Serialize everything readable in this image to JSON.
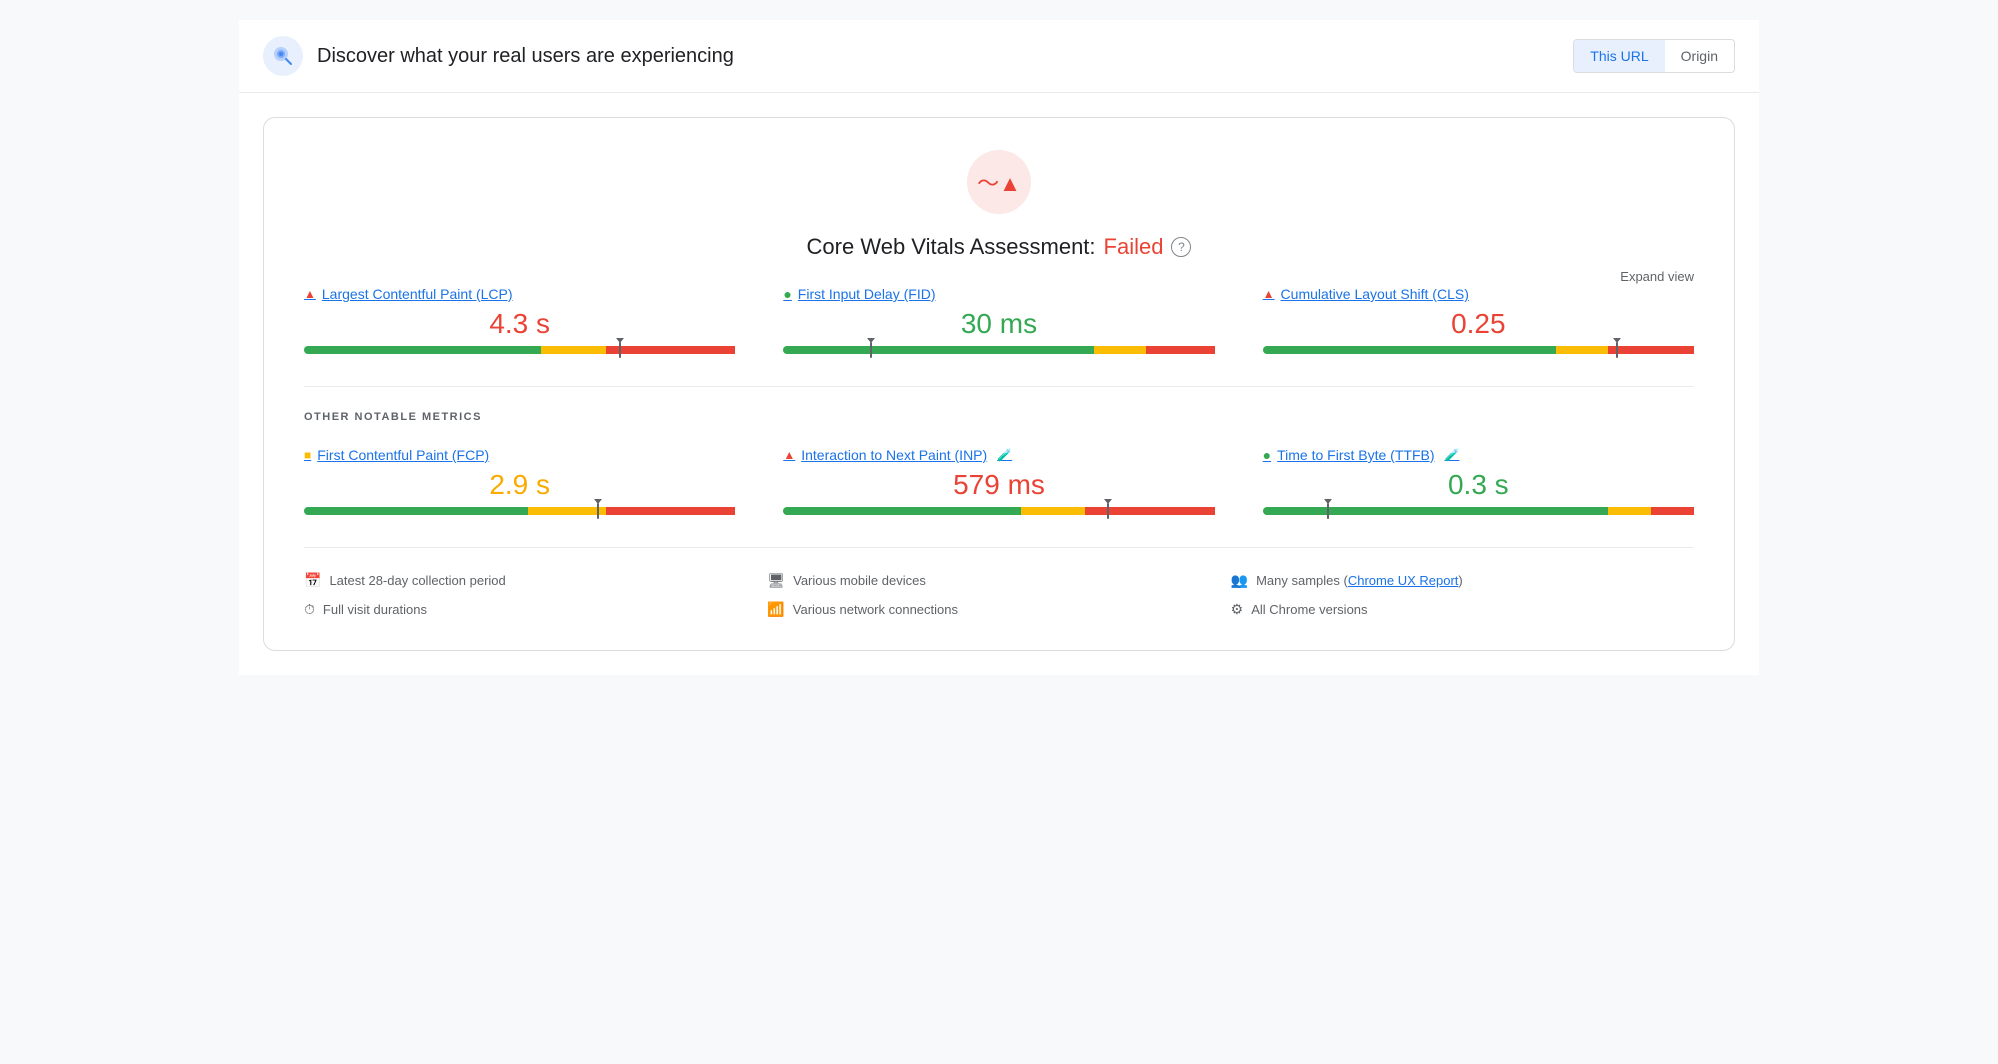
{
  "header": {
    "title": "Discover what your real users are experiencing",
    "toggle": {
      "this_url": "This URL",
      "origin": "Origin",
      "active": "this_url"
    },
    "logo_alt": "PageSpeed Insights logo"
  },
  "assessment": {
    "title_prefix": "Core Web Vitals Assessment: ",
    "status": "Failed",
    "help_label": "?",
    "expand_label": "Expand view"
  },
  "core_metrics": [
    {
      "id": "lcp",
      "icon_type": "triangle",
      "icon_color": "red",
      "title": "Largest Contentful Paint (LCP)",
      "value": "4.3 s",
      "value_color": "red",
      "bar": {
        "green": 55,
        "orange": 15,
        "red": 30,
        "marker_pct": 73
      }
    },
    {
      "id": "fid",
      "icon_type": "circle",
      "icon_color": "green",
      "title": "First Input Delay (FID)",
      "value": "30 ms",
      "value_color": "green",
      "bar": {
        "green": 72,
        "orange": 12,
        "red": 16,
        "marker_pct": 20
      }
    },
    {
      "id": "cls",
      "icon_type": "triangle",
      "icon_color": "red",
      "title": "Cumulative Layout Shift (CLS)",
      "value": "0.25",
      "value_color": "red",
      "bar": {
        "green": 68,
        "orange": 12,
        "red": 20,
        "marker_pct": 82
      }
    }
  ],
  "other_metrics_label": "OTHER NOTABLE METRICS",
  "other_metrics": [
    {
      "id": "fcp",
      "icon_type": "square",
      "icon_color": "orange",
      "title": "First Contentful Paint (FCP)",
      "value": "2.9 s",
      "value_color": "orange",
      "bar": {
        "green": 52,
        "orange": 18,
        "red": 30,
        "marker_pct": 68
      },
      "lab": false
    },
    {
      "id": "inp",
      "icon_type": "triangle",
      "icon_color": "red",
      "title": "Interaction to Next Paint (INP)",
      "value": "579 ms",
      "value_color": "red",
      "bar": {
        "green": 55,
        "orange": 15,
        "red": 30,
        "marker_pct": 75
      },
      "lab": true
    },
    {
      "id": "ttfb",
      "icon_type": "circle",
      "icon_color": "green",
      "title": "Time to First Byte (TTFB)",
      "value": "0.3 s",
      "value_color": "green",
      "bar": {
        "green": 80,
        "orange": 10,
        "red": 10,
        "marker_pct": 15
      },
      "lab": true
    }
  ],
  "footer": [
    {
      "icon": "📅",
      "text": "Latest 28-day collection period"
    },
    {
      "icon": "🖥",
      "text": "Various mobile devices"
    },
    {
      "icon": "👥",
      "text": "Many samples (",
      "link": "Chrome UX Report",
      "text_after": ")"
    },
    {
      "icon": "⏱",
      "text": "Full visit durations"
    },
    {
      "icon": "📶",
      "text": "Various network connections"
    },
    {
      "icon": "⚙",
      "text": "All Chrome versions"
    }
  ]
}
